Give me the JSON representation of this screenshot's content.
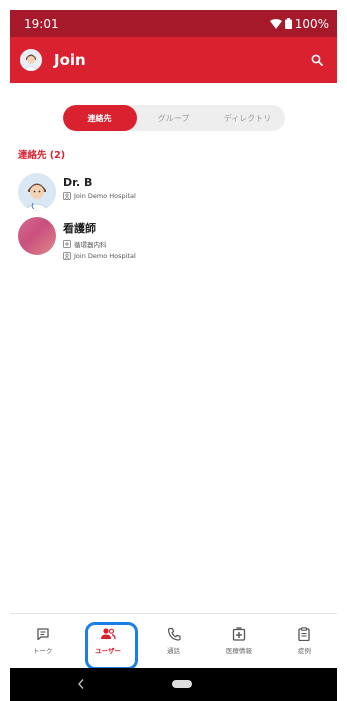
{
  "status_bar": {
    "time": "19:01",
    "battery": "100%"
  },
  "app_bar": {
    "title": "Join"
  },
  "tabs": [
    {
      "label": "連絡先",
      "active": true
    },
    {
      "label": "グループ",
      "active": false
    },
    {
      "label": "ディレクトリ",
      "active": false
    }
  ],
  "section": {
    "title": "連絡先 (2)"
  },
  "contacts": [
    {
      "name": "Dr. B",
      "hospital": "Join Demo Hospital"
    },
    {
      "name": "看護師",
      "department": "循環器内科",
      "hospital": "Join Demo Hospital"
    }
  ],
  "bottom_nav": [
    {
      "label": "トーク",
      "icon": "chat-icon",
      "active": false
    },
    {
      "label": "ユーザー",
      "icon": "users-icon",
      "active": true
    },
    {
      "label": "通話",
      "icon": "phone-icon",
      "active": false
    },
    {
      "label": "医療情報",
      "icon": "medical-plus-icon",
      "active": false
    },
    {
      "label": "症例",
      "icon": "clipboard-icon",
      "active": false
    }
  ],
  "colors": {
    "primary": "#d9212f",
    "status_bar": "#a5192a",
    "highlight": "#1a7de8"
  }
}
